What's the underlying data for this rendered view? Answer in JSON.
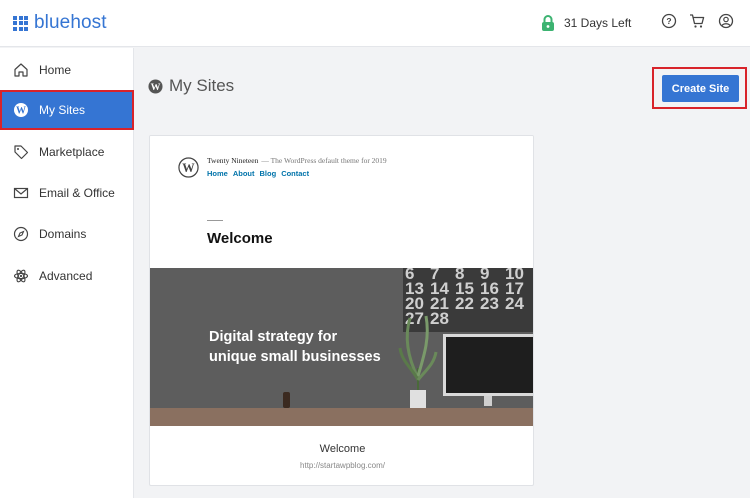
{
  "header": {
    "brand": "bluehost",
    "trial_text": "31 Days Left",
    "icons": [
      "help-icon",
      "cart-icon",
      "account-icon"
    ]
  },
  "sidebar": {
    "items": [
      {
        "label": "Home",
        "icon": "home-icon"
      },
      {
        "label": "My Sites",
        "icon": "wordpress-icon",
        "active": true
      },
      {
        "label": "Marketplace",
        "icon": "tag-icon"
      },
      {
        "label": "Email & Office",
        "icon": "mail-icon"
      },
      {
        "label": "Domains",
        "icon": "compass-icon"
      },
      {
        "label": "Advanced",
        "icon": "atom-icon"
      }
    ]
  },
  "main": {
    "title": "My Sites",
    "create_button": "Create Site"
  },
  "site_card": {
    "preview": {
      "site_name": "Twenty Nineteen",
      "tagline": "— The WordPress default theme for 2019",
      "menu": [
        "Home",
        "About",
        "Blog",
        "Contact"
      ],
      "heading": "Welcome",
      "hero_line1": "Digital strategy for",
      "hero_line2": "unique small businesses",
      "calendar_numbers": [
        "6",
        "7",
        "8",
        "9",
        "10",
        "13",
        "14",
        "15",
        "16",
        "17",
        "20",
        "21",
        "22",
        "23",
        "24",
        "27",
        "28",
        "",
        "",
        ""
      ]
    },
    "title": "Welcome",
    "url": "http://startawpblog.com/"
  },
  "colors": {
    "accent": "#3575d3",
    "highlight": "#d8232a",
    "background": "#f2f3f5",
    "lock": "#3cb371"
  }
}
